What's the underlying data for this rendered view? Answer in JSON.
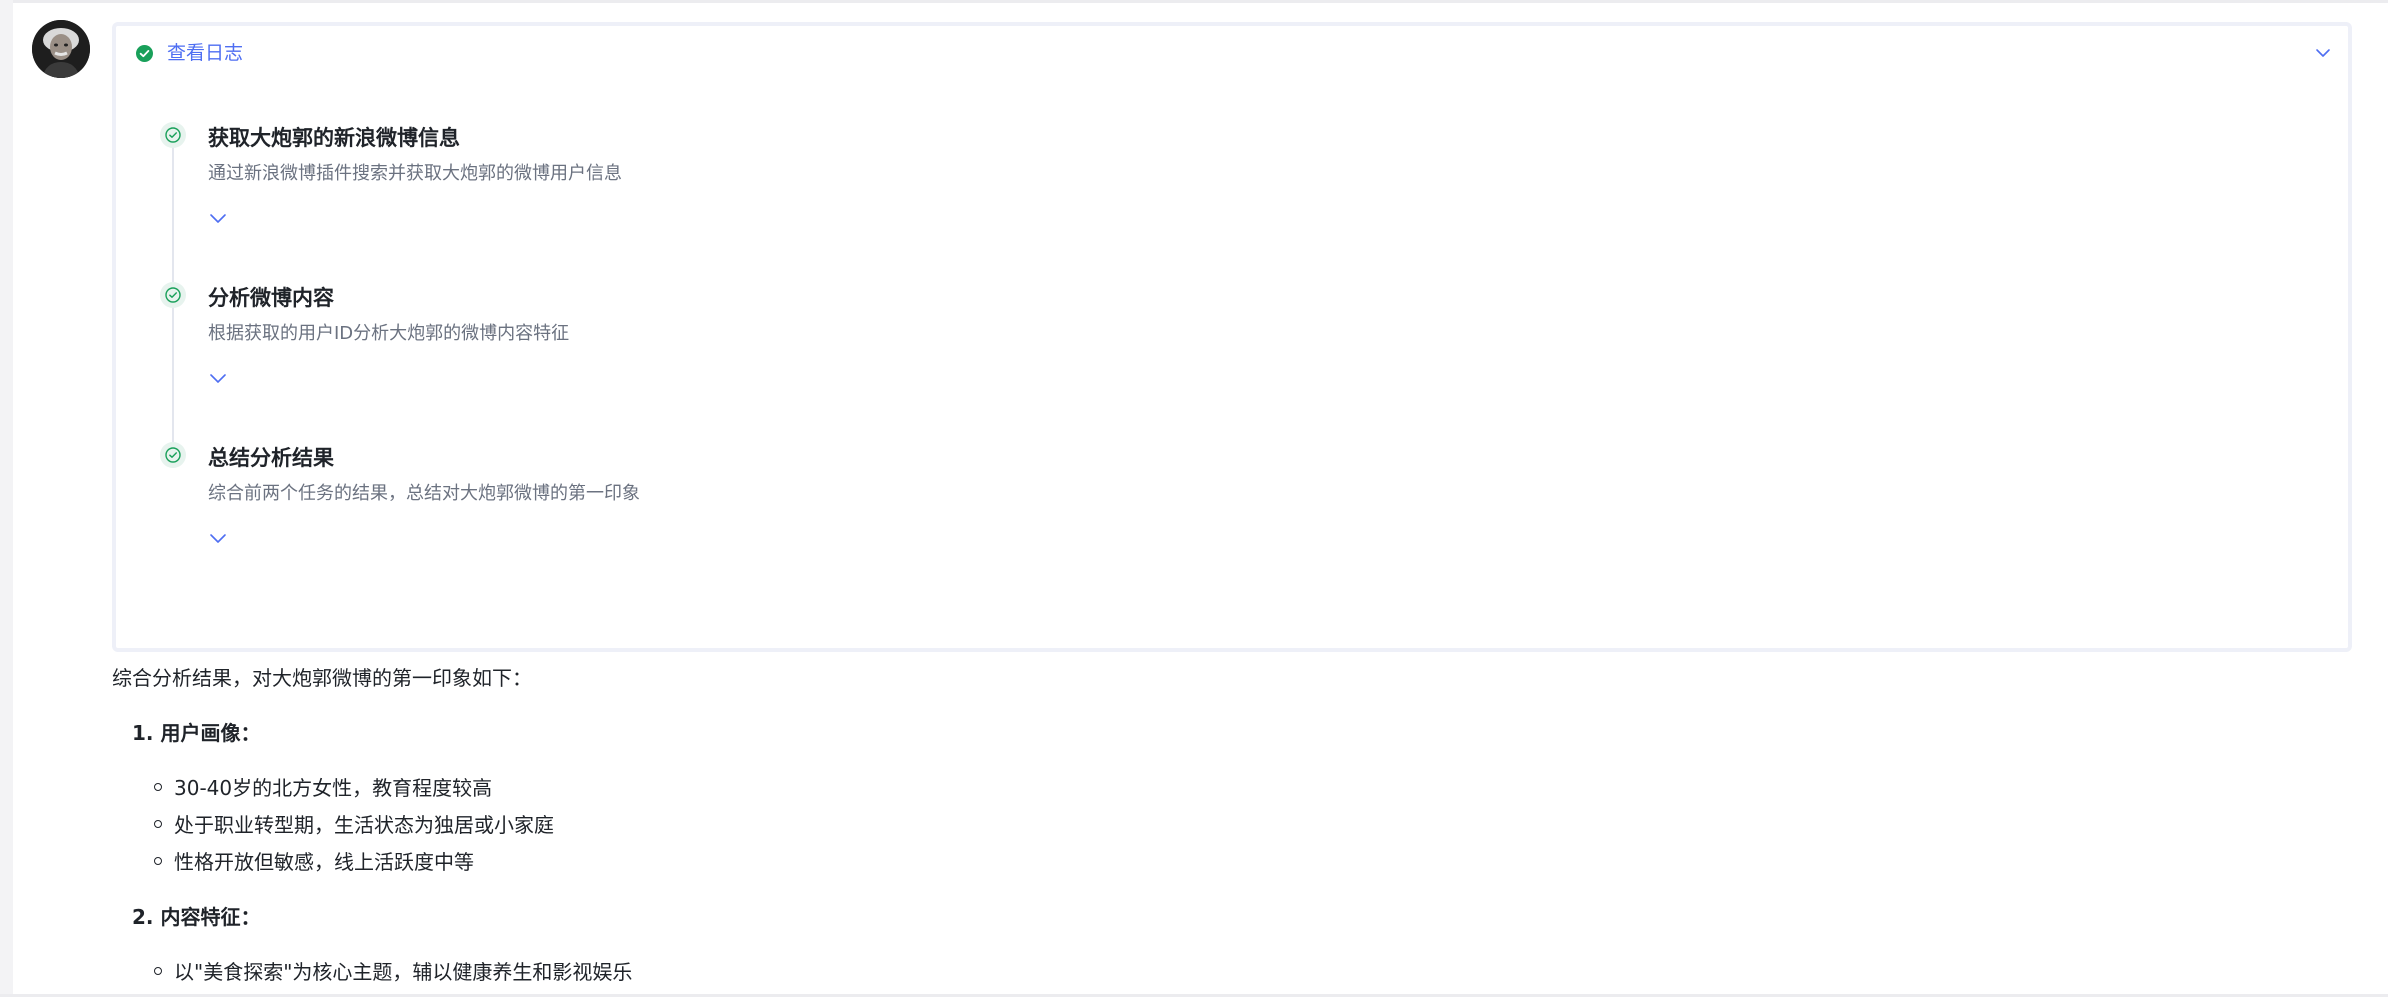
{
  "log": {
    "title": "查看日志",
    "steps": [
      {
        "title": "获取大炮郭的新浪微博信息",
        "description": "通过新浪微博插件搜索并获取大炮郭的微博用户信息"
      },
      {
        "title": "分析微博内容",
        "description": "根据获取的用户ID分析大炮郭的微博内容特征"
      },
      {
        "title": "总结分析结果",
        "description": "综合前两个任务的结果，总结对大炮郭微博的第一印象"
      }
    ]
  },
  "answer": {
    "intro": "综合分析结果，对大炮郭微博的第一印象如下：",
    "sections": [
      {
        "heading": "1. 用户画像：",
        "items": [
          "30-40岁的北方女性，教育程度较高",
          "处于职业转型期，生活状态为独居或小家庭",
          "性格开放但敏感，线上活跃度中等"
        ]
      },
      {
        "heading": "2. 内容特征：",
        "items": [
          "以\"美食探索\"为核心主题，辅以健康养生和影视娱乐"
        ]
      }
    ]
  },
  "colors": {
    "accent": "#4e6ef2",
    "success": "#19a05a",
    "step_icon_bg": "#e7f3ee",
    "muted_text": "#6b7280"
  }
}
